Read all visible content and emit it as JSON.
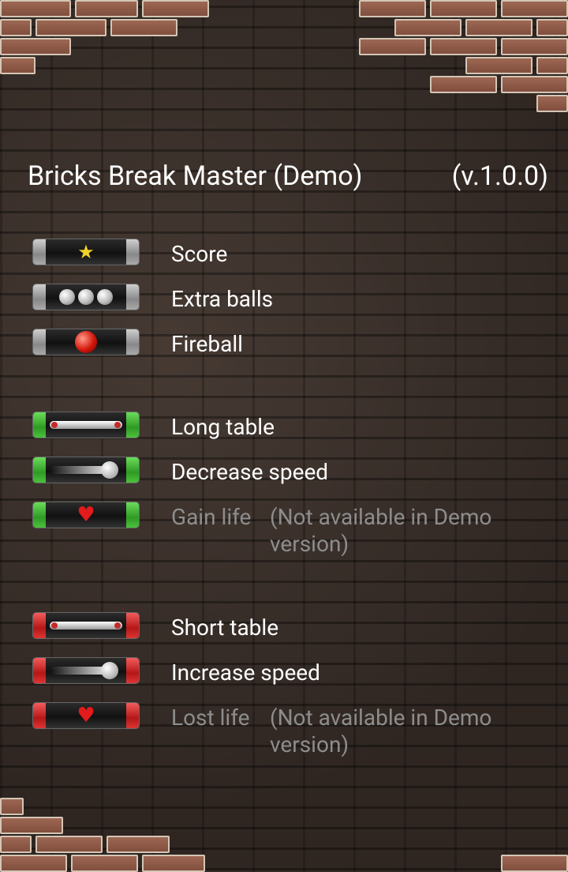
{
  "header": {
    "title": "Bricks Break Master (Demo)",
    "version": "(v.1.0.0)"
  },
  "legend": {
    "bonus": [
      {
        "label": "Score",
        "icon": "star-icon"
      },
      {
        "label": "Extra balls",
        "icon": "extra-balls-icon"
      },
      {
        "label": "Fireball",
        "icon": "fireball-icon"
      }
    ],
    "good": [
      {
        "label": "Long table",
        "icon": "long-table-icon"
      },
      {
        "label": "Decrease speed",
        "icon": "decrease-speed-icon"
      },
      {
        "label": "Gain life",
        "icon": "heart-icon",
        "note": "(Not available in Demo version)"
      }
    ],
    "bad": [
      {
        "label": "Short table",
        "icon": "short-table-icon"
      },
      {
        "label": "Increase speed",
        "icon": "increase-speed-icon"
      },
      {
        "label": "Lost life",
        "icon": "heart-icon",
        "note": "(Not available in Demo version)"
      }
    ]
  },
  "colors": {
    "grey_cap": "#aaaaaa",
    "good_cap": "#3cb52f",
    "bad_cap": "#d42222",
    "text": "#ffffff",
    "disabled_text": "#8d8d8d"
  }
}
